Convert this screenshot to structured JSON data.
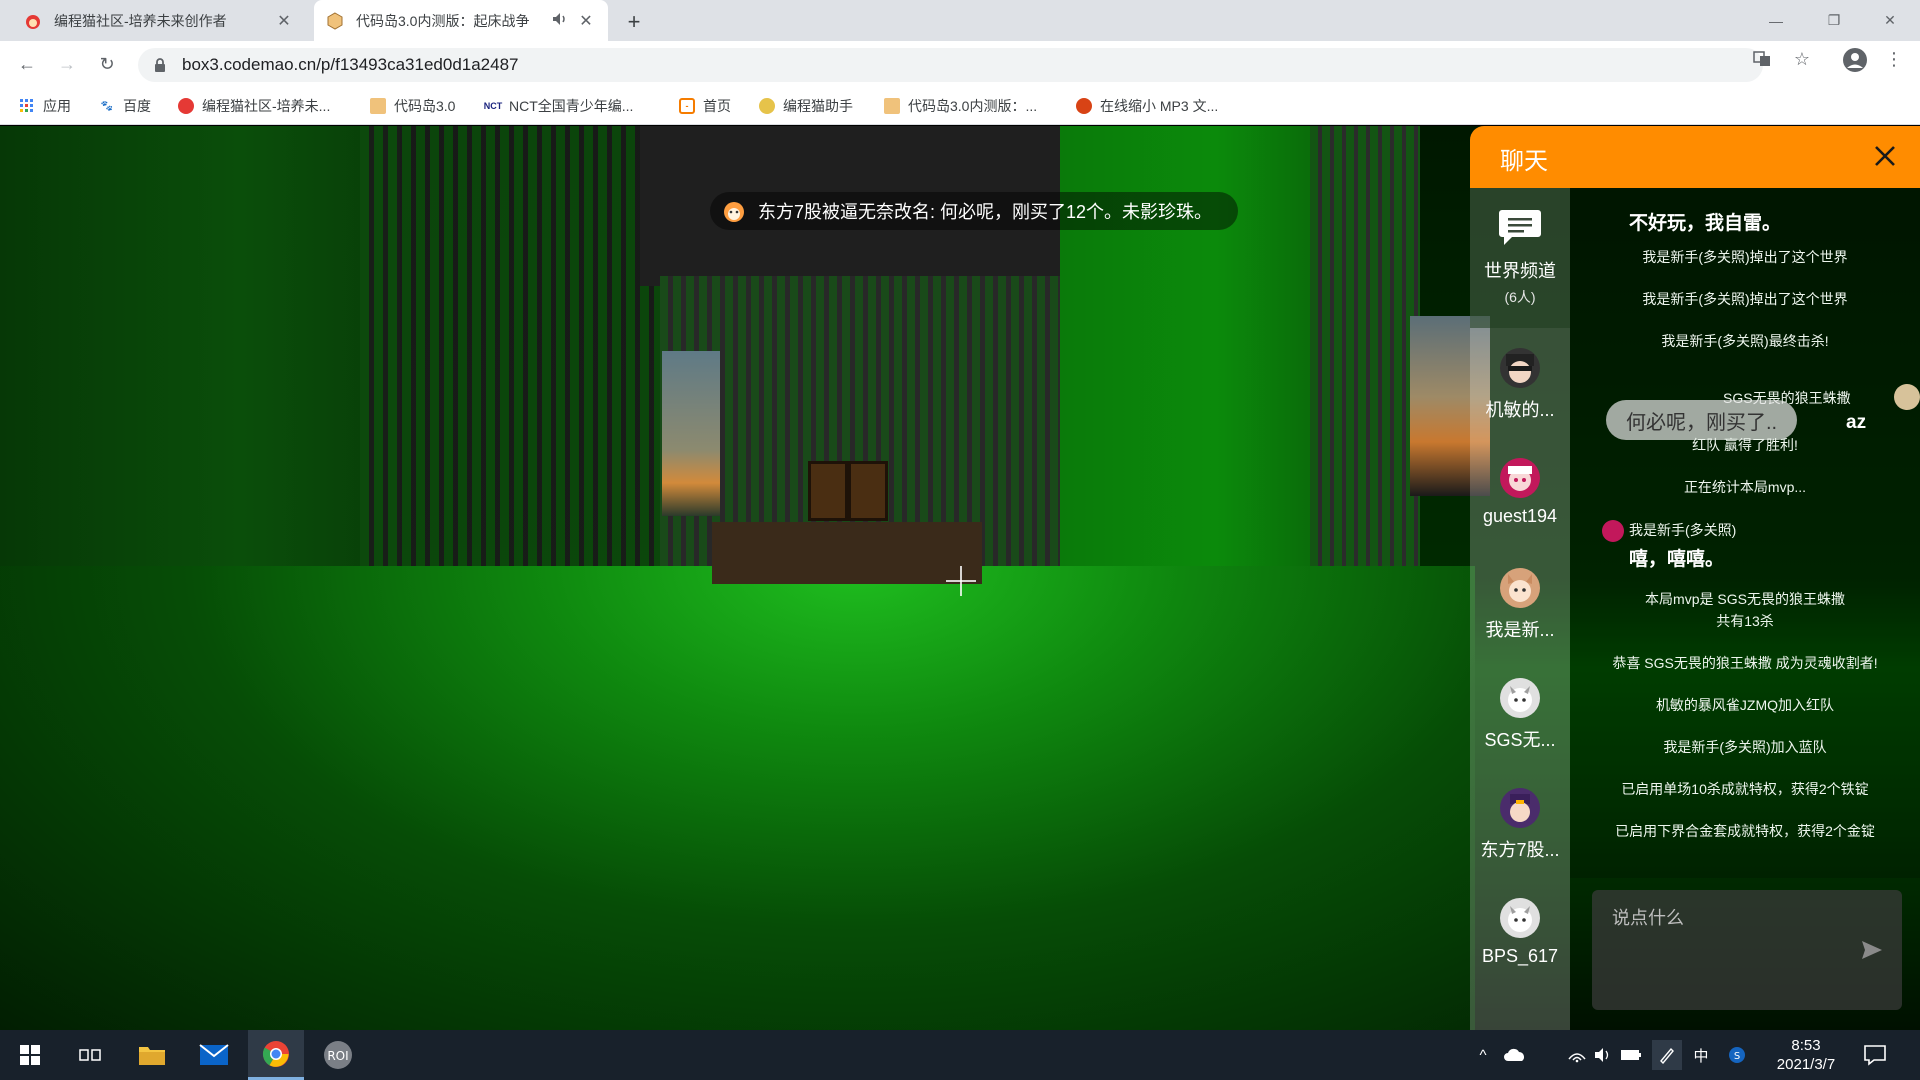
{
  "browser": {
    "tabs": [
      {
        "title": "编程猫社区-培养未来创作者",
        "active": false
      },
      {
        "title": "代码岛3.0内测版：起床战争",
        "active": true
      }
    ],
    "url": "box3.codemao.cn/p/f13493ca31ed0d1a2487",
    "bookmarks": [
      {
        "label": "应用"
      },
      {
        "label": "百度"
      },
      {
        "label": "编程猫社区-培养未..."
      },
      {
        "label": "代码岛3.0"
      },
      {
        "label": "NCT全国青少年编..."
      },
      {
        "label": "首页"
      },
      {
        "label": "编程猫助手"
      },
      {
        "label": "代码岛3.0内测版：..."
      },
      {
        "label": "在线缩小 MP3 文..."
      }
    ]
  },
  "game": {
    "toast": "东方7股被逼无奈改名: 何必呢，刚买了12个。未影珍珠。"
  },
  "chat": {
    "title": "聊天",
    "world_channel": {
      "label": "世界频道",
      "count": "(6人)"
    },
    "users": [
      {
        "name": "机敏的..."
      },
      {
        "name": "guest194"
      },
      {
        "name": "我是新..."
      },
      {
        "name": "SGS无..."
      },
      {
        "name": "东方7股..."
      },
      {
        "name": "BPS_617"
      }
    ],
    "messages": {
      "m1_text": "不好玩，我自雷。",
      "s1": "我是新手(多关照)掉出了这个世界",
      "s2": "我是新手(多关照)掉出了这个世界",
      "s3": "我是新手(多关照)最终击杀!",
      "m2_name": "SGS无畏的狼王蛛撒",
      "m2_bubble": "何必呢，刚买了..",
      "m2_text": "az",
      "s4": "红队 赢得了胜利!",
      "s5": "正在统计本局mvp...",
      "m3_name": "我是新手(多关照)",
      "m3_text": "嘻，嘻嘻。",
      "s6a": "本局mvp是 SGS无畏的狼王蛛撒",
      "s6b": "共有13杀",
      "s7": "恭喜 SGS无畏的狼王蛛撒 成为灵魂收割者!",
      "s8": "机敏的暴风雀JZMQ加入红队",
      "s9": "我是新手(多关照)加入蓝队",
      "s10": "已启用单场10杀成就特权，获得2个铁锭",
      "s11": "已启用下界合金套成就特权，获得2个金锭"
    },
    "input_placeholder": "说点什么",
    "accent": "#ff8c00"
  },
  "taskbar": {
    "time": "8:53",
    "date": "2021/3/7",
    "ime": "中"
  }
}
